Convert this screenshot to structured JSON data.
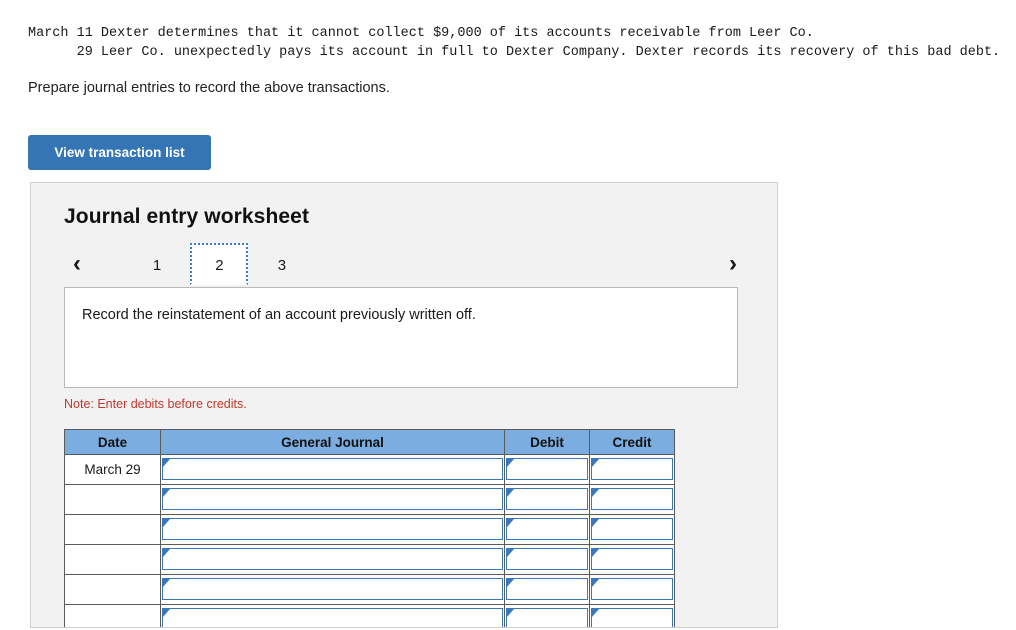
{
  "top_fragment": "-",
  "problem": {
    "line1": "March 11 Dexter determines that it cannot collect $9,000 of its accounts receivable from Leer Co.",
    "line2": "      29 Leer Co. unexpectedly pays its account in full to Dexter Company. Dexter records its recovery of this bad debt."
  },
  "instruction": "Prepare journal entries to record the above transactions.",
  "buttons": {
    "view_transaction_list": "View transaction list"
  },
  "worksheet": {
    "title": "Journal entry worksheet",
    "pager": {
      "prev_icon": "‹",
      "next_icon": "›",
      "tabs": [
        "1",
        "2",
        "3"
      ],
      "active_index": 1
    },
    "description": "Record the reinstatement of an account previously written off.",
    "note": "Note: Enter debits before credits.",
    "table": {
      "headers": [
        "Date",
        "General Journal",
        "Debit",
        "Credit"
      ],
      "rows": [
        {
          "date": "March 29",
          "journal": "",
          "debit": "",
          "credit": ""
        },
        {
          "date": "",
          "journal": "",
          "debit": "",
          "credit": ""
        },
        {
          "date": "",
          "journal": "",
          "debit": "",
          "credit": ""
        },
        {
          "date": "",
          "journal": "",
          "debit": "",
          "credit": ""
        },
        {
          "date": "",
          "journal": "",
          "debit": "",
          "credit": ""
        },
        {
          "date": "",
          "journal": "",
          "debit": "",
          "credit": ""
        }
      ]
    }
  },
  "colors": {
    "button_blue": "#3575b5",
    "header_blue": "#7badE0",
    "field_border_blue": "#3b78b8",
    "note_red": "#c0392b",
    "panel_gray": "#f2f2f2"
  }
}
